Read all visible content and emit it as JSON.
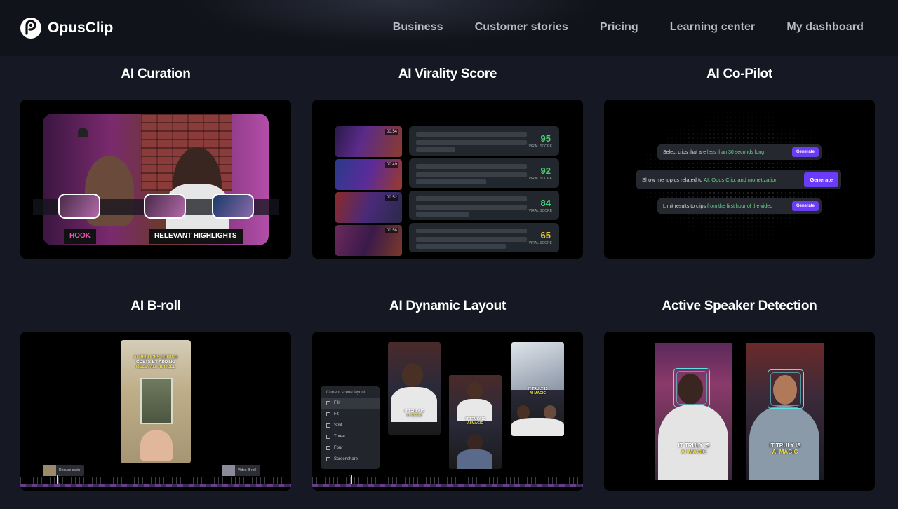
{
  "brand": {
    "name": "OpusClip",
    "logo_icon": "opusclip-logo-icon"
  },
  "nav": [
    {
      "label": "Business"
    },
    {
      "label": "Customer stories"
    },
    {
      "label": "Pricing"
    },
    {
      "label": "Learning center"
    },
    {
      "label": "My dashboard"
    }
  ],
  "features": [
    {
      "title": "AI Curation"
    },
    {
      "title": "AI Virality Score"
    },
    {
      "title": "AI Co-Pilot"
    },
    {
      "title": "AI B-roll"
    },
    {
      "title": "AI Dynamic Layout"
    },
    {
      "title": "Active Speaker Detection"
    }
  ],
  "curation": {
    "tag_hook": "HOOK",
    "tag_highlights": "RELEVANT HIGHLIGHTS"
  },
  "virality": {
    "label": "VIRAL SCORE",
    "rows": [
      {
        "time": "00:54",
        "score": "95",
        "color": "#4fd17a"
      },
      {
        "time": "00:49",
        "score": "92",
        "color": "#4fd17a"
      },
      {
        "time": "00:52",
        "score": "84",
        "color": "#4fd17a"
      },
      {
        "time": "00:58",
        "score": "65",
        "color": "#e8c93a"
      }
    ]
  },
  "copilot": {
    "button": "Generate",
    "prompts": [
      {
        "before": "Select clips that are ",
        "highlight": "less than 30 seconds long",
        "after": ""
      },
      {
        "before": "Show me topics related to ",
        "highlight": "AI, Opus Clip, and monetization",
        "after": ""
      },
      {
        "before": "Limit results to clips ",
        "highlight": "from the first hour of the video",
        "after": ""
      }
    ]
  },
  "broll": {
    "caption_y1": "AI REDUCES EDITING",
    "caption_w": "COSTS BY ADDING",
    "caption_y2": "RELEVANT B-ROLL",
    "chip_left": "Reduce costs",
    "chip_right": "Video B-roll"
  },
  "layout": {
    "panel_title": "Current scene layout",
    "options": [
      "Fill",
      "Fit",
      "Split",
      "Three",
      "Four",
      "Screenshare"
    ],
    "caption_w": "IT TRULY IS",
    "caption_y": "AI MAGIC"
  },
  "speaker": {
    "caption_w": "IT TRULY IS",
    "caption_y": "AI MAGIC"
  }
}
